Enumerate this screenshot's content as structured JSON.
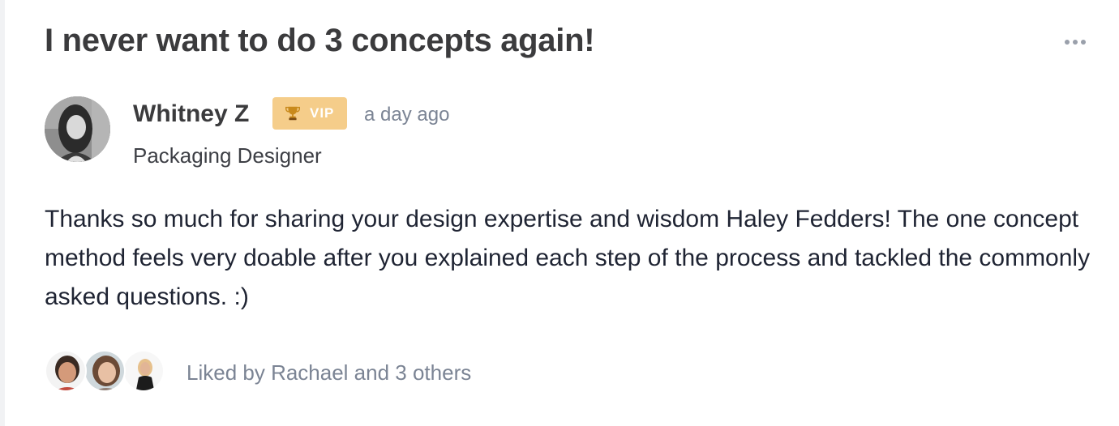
{
  "post": {
    "title": "I never want to do 3 concepts again!",
    "author": {
      "name": "Whitney Z",
      "badge_label": "VIP",
      "badge_icon": "trophy-icon",
      "badge_color": "#f5cd8a",
      "timestamp": "a day ago",
      "role": "Packaging Designer"
    },
    "body": "Thanks so much for sharing your design expertise and wisdom Haley Fedders! The one concept method feels very doable after you explained each step of the process and tackled the commonly asked questions. :)",
    "likes": {
      "text": "Liked by Rachael and 3 others",
      "avatar_count_shown": 3
    },
    "more_menu_icon": "more-horizontal-icon"
  },
  "colors": {
    "title": "#3b3b3d",
    "body": "#1f2433",
    "muted": "#7b8494"
  }
}
